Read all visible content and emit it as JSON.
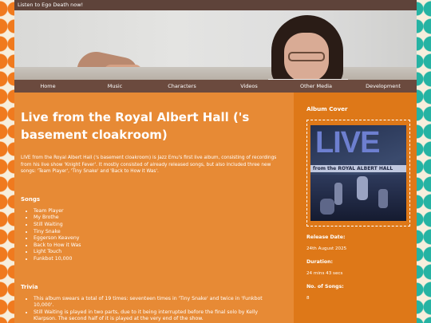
{
  "topbar": {
    "text": "Listen to Ego Death now!"
  },
  "nav": [
    "Home",
    "Music",
    "Characters",
    "Videos",
    "Other Media",
    "Development"
  ],
  "main": {
    "title": "Live from the Royal Albert Hall ('s basement cloakroom)",
    "description": "LIVE from the Royal Albert Hall ('s basement cloakroom) is Jazz Emu's first live album, consisting of recordings from his live show 'Knight Fever'. It mostly consisted of already released songs, but also included three new songs: 'Team Player', 'Tiny Snake' and 'Back to How it Was'.",
    "songs_heading": "Songs",
    "songs": [
      "Team Player",
      "My Brothe",
      "Still Waiting",
      "Tiny Snake",
      "Eggerson Keaveny",
      "Back to How it Was",
      "Light Touch",
      "Funkbot 10,000"
    ],
    "trivia_heading": "Trivia",
    "trivia": [
      "This album swears a total of 19 times: seventeen times in 'Tiny Snake' and twice in 'Funkbot 10,000'.",
      "Still Waiting is played in two parts, due to it being interrupted before the final solo by Kelly Klarpson. The second half of it is played at the very end of the show."
    ]
  },
  "sidebar": {
    "cover_heading": "Album Cover",
    "cover_text": {
      "live": "LIVE",
      "strip": "from the  ROYAL ALBERT HALL"
    },
    "release_label": "Release Date:",
    "release_value": "24th August 2025",
    "duration_label": "Duration:",
    "duration_value": "24 mins 43 secs",
    "songs_label": "No. of Songs:",
    "songs_value": "8"
  }
}
